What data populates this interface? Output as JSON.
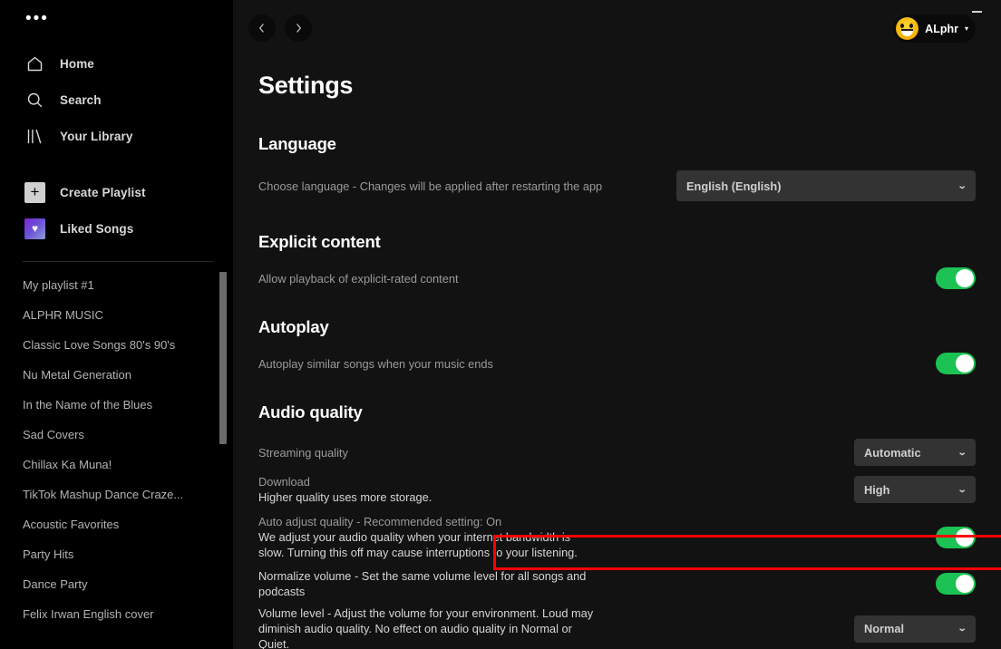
{
  "sidebar": {
    "menu_icon": "more-horizontal-icon",
    "nav": [
      {
        "label": "Home",
        "icon": "home-icon"
      },
      {
        "label": "Search",
        "icon": "search-icon"
      },
      {
        "label": "Your Library",
        "icon": "library-icon"
      }
    ],
    "actions": [
      {
        "label": "Create Playlist",
        "icon": "plus-icon"
      },
      {
        "label": "Liked Songs",
        "icon": "heart-icon"
      }
    ],
    "playlists": [
      "My playlist #1",
      "ALPHR MUSIC",
      "Classic Love Songs 80's 90's",
      "Nu Metal Generation",
      "In the Name of the Blues",
      "Sad Covers",
      "Chillax Ka Muna!",
      "TikTok Mashup Dance Craze...",
      "Acoustic Favorites",
      "Party Hits",
      "Dance Party",
      "Felix Irwan English cover"
    ]
  },
  "topbar": {
    "back_icon": "chevron-left-icon",
    "forward_icon": "chevron-right-icon",
    "user_name": "ALphr",
    "user_caret": "▾",
    "minimize_icon": "minimize-icon"
  },
  "page": {
    "title": "Settings"
  },
  "sections": {
    "language": {
      "title": "Language",
      "row_label": "Choose language - Changes will be applied after restarting the app",
      "dropdown_value": "English (English)",
      "caret": "⌄"
    },
    "explicit": {
      "title": "Explicit content",
      "row_label": "Allow playback of explicit-rated content",
      "toggle_state": "on"
    },
    "autoplay": {
      "title": "Autoplay",
      "row_label": "Autoplay similar songs when your music ends",
      "toggle_state": "on"
    },
    "audio_quality": {
      "title": "Audio quality",
      "streaming": {
        "label": "Streaming quality",
        "dropdown_value": "Automatic",
        "caret": "⌄"
      },
      "download": {
        "label": "Download",
        "sublabel": "Higher quality uses more storage.",
        "dropdown_value": "High",
        "caret": "⌄"
      },
      "auto_adjust": {
        "label": "Auto adjust quality - Recommended setting: On",
        "desc_line1": "We adjust your audio quality when your internet bandwidth is",
        "desc_line2": "slow. Turning this off may cause interruptions to your listening.",
        "toggle_state": "on"
      },
      "normalize": {
        "label_line1": "Normalize volume - Set the same volume level for all songs and",
        "label_line2": "podcasts",
        "toggle_state": "on",
        "highlighted": true
      },
      "volume_level": {
        "line1": "Volume level - Adjust the volume for your environment. Loud may",
        "line2": "diminish audio quality. No effect on audio quality in Normal or",
        "line3": "Quiet.",
        "dropdown_value": "Normal",
        "caret": "⌄"
      }
    }
  },
  "colors": {
    "sidebar_bg": "#000000",
    "main_bg": "#121212",
    "accent_green": "#1cc253",
    "dropdown_bg": "#333333",
    "highlight_red": "#ff0000",
    "text_primary": "#ffffff",
    "text_muted": "#9a9a9a"
  }
}
